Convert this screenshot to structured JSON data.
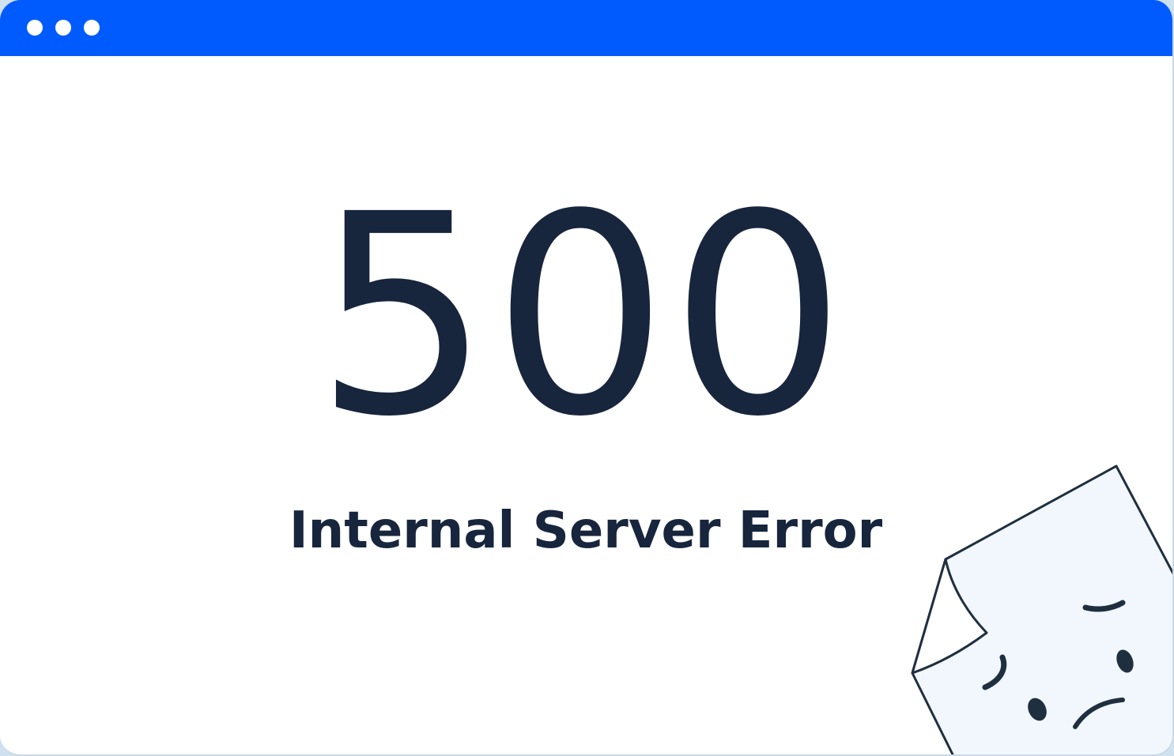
{
  "window": {
    "accent_color": "#005bff",
    "controls": [
      "dot",
      "dot",
      "dot"
    ]
  },
  "error": {
    "code": "500",
    "message": "Internal Server Error",
    "text_color": "#17253d"
  },
  "illustration": {
    "icon": "sad-page-icon"
  }
}
